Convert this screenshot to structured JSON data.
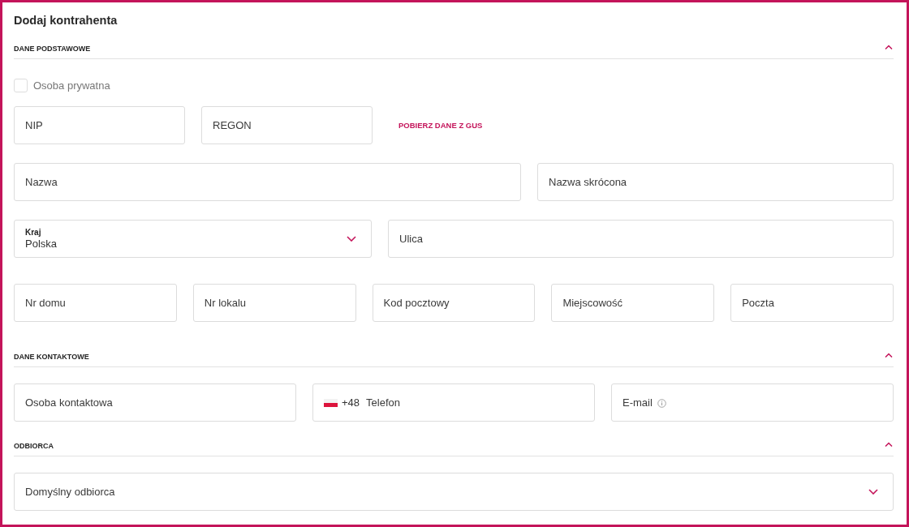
{
  "title": "Dodaj kontrahenta",
  "sections": [
    {
      "title": "DANE PODSTAWOWE",
      "expanded": true,
      "groups": [
        {
          "fields": [
            {
              "kind": "checkbox",
              "label": "Osoba prywatna",
              "checked": false
            }
          ]
        },
        {
          "fields": [
            {
              "kind": "input",
              "placeholder": "NIP"
            },
            {
              "kind": "input",
              "placeholder": "REGON"
            },
            {
              "kind": "link",
              "label": "POBIERZ DANE Z GUS"
            }
          ]
        },
        {
          "fields": [
            {
              "kind": "input",
              "placeholder": "Nazwa"
            },
            {
              "kind": "input",
              "placeholder": "Nazwa skrócona"
            }
          ]
        },
        {
          "fields": [
            {
              "kind": "select",
              "label": "Kraj",
              "value": "Polska"
            },
            {
              "kind": "input",
              "placeholder": "Ulica"
            }
          ]
        },
        {
          "fields": [
            {
              "kind": "input",
              "placeholder": "Nr domu"
            },
            {
              "kind": "input",
              "placeholder": "Nr lokalu"
            },
            {
              "kind": "input",
              "placeholder": "Kod pocztowy"
            },
            {
              "kind": "input",
              "placeholder": "Miejscowość"
            },
            {
              "kind": "input",
              "placeholder": "Poczta"
            }
          ]
        }
      ]
    },
    {
      "title": "DANE KONTAKTOWE",
      "expanded": true,
      "groups": [
        {
          "fields": [
            {
              "kind": "input",
              "placeholder": "Osoba kontaktowa"
            },
            {
              "kind": "phone",
              "prefix": "+48",
              "placeholder": "Telefon"
            },
            {
              "kind": "info-input",
              "placeholder": "E-mail"
            }
          ]
        }
      ]
    },
    {
      "title": "ODBIORCA",
      "expanded": true,
      "groups": [
        {
          "fields": [
            {
              "kind": "select",
              "placeholder": "Domyślny odbiorca"
            }
          ]
        }
      ]
    }
  ]
}
